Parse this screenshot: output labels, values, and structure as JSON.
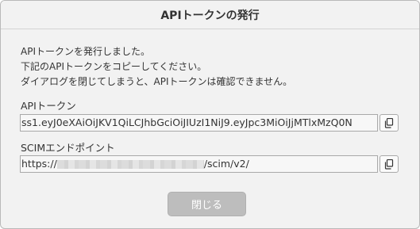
{
  "dialog": {
    "title": "APIトークンの発行",
    "message_lines": [
      "APIトークンを発行しました。",
      "下記のAPIトークンをコピーしてください。",
      "ダイアログを閉じてしまうと、APIトークンは確認できません。"
    ],
    "api_token": {
      "label": "APIトークン",
      "value": "ss1.eyJ0eXAiOiJKV1QiLCJhbGciOiJIUzI1NiJ9.eyJpc3MiOiJjMTlxMzQ0N"
    },
    "scim_endpoint": {
      "label": "SCIMエンドポイント",
      "value_prefix": "https://",
      "value_suffix": "/scim/v2/"
    },
    "close_label": "閉じる"
  },
  "icons": {
    "copy": "copy-icon"
  }
}
